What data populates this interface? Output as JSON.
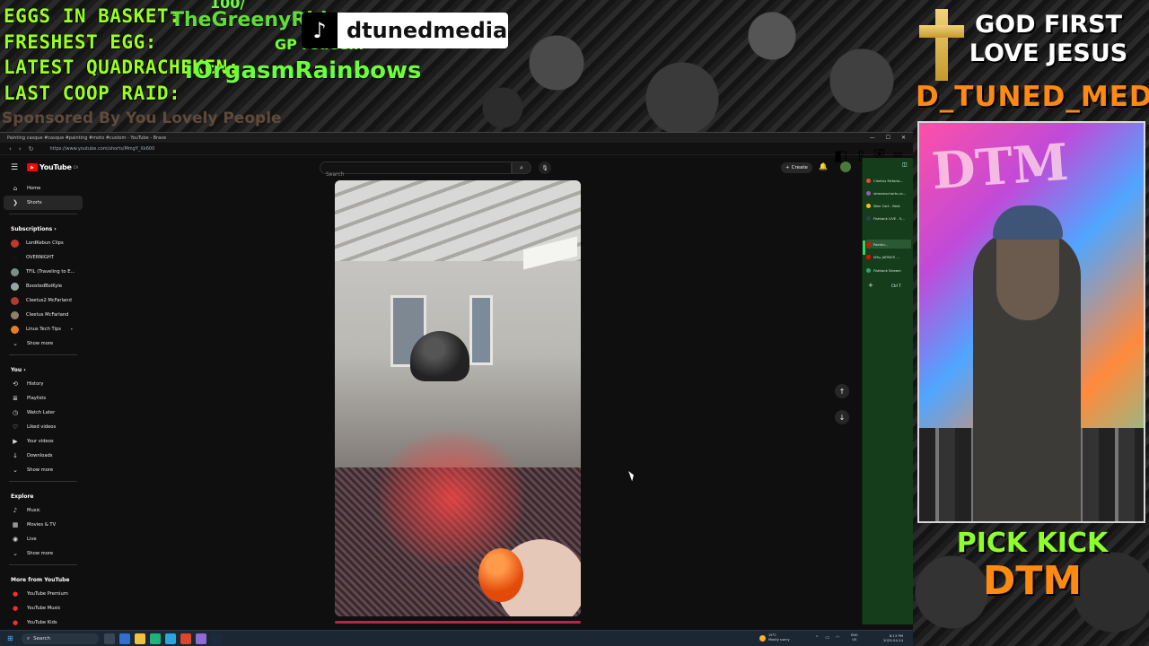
{
  "overlay": {
    "stats": [
      "EGGS IN BASKET:",
      "FRESHEST EGG:",
      "LATEST QUADRACHEKEN:",
      "LAST COOP RAID:"
    ],
    "sponsor": "Sponsored By You Lovely People",
    "alert_number": "100/",
    "alert_name": "TheGreenyRid",
    "alert_gp": "GP redeem",
    "alert_name2": "iOrgasmRainbows",
    "tiktok_handle": "dtunedmedia",
    "faith_text": "GOD FIRST LOVE JESUS",
    "channel_name": "D_TUNED_MEDIA",
    "pick_kick": "PICK KICK",
    "dtm": "DTM",
    "webcam_wall_text": "DTM"
  },
  "browser": {
    "window_title": "Painting casque #casque #painting #moto #custom - YouTube - Brave",
    "url": "https://www.youtube.com/shorts/MmgY_Xk600",
    "nav_back": "‹",
    "nav_fwd": "›",
    "reload": "↻"
  },
  "youtube": {
    "logo_text": "YouTube",
    "country": "CA",
    "search_placeholder": "Search",
    "create_label": "Create",
    "sidebar": {
      "main": [
        {
          "icon": "home-icon",
          "glyph": "⌂",
          "label": "Home",
          "active": false
        },
        {
          "icon": "shorts-icon",
          "glyph": "❯",
          "label": "Shorts",
          "active": true
        }
      ],
      "subscriptions_heading": "Subscriptions",
      "subscriptions": [
        {
          "label": "LordKebun Clips",
          "color": "#c0392b"
        },
        {
          "label": "OVERNIGHT",
          "color": "#111111"
        },
        {
          "label": "TFIL (Traveling to E...",
          "color": "#7f8c8d"
        },
        {
          "label": "BoostedBoiKyle",
          "color": "#95a5a6"
        },
        {
          "label": "Cleetus2 McFarland",
          "color": "#b03a2e"
        },
        {
          "label": "Cleetus McFarland",
          "color": "#8e7f6b"
        },
        {
          "label": "Linus Tech Tips",
          "color": "#e67e22"
        }
      ],
      "subs_show_more": "Show more",
      "you_heading": "You",
      "you_items": [
        {
          "icon": "history-icon",
          "glyph": "⟲",
          "label": "History"
        },
        {
          "icon": "playlists-icon",
          "glyph": "≣",
          "label": "Playlists"
        },
        {
          "icon": "watch-later-icon",
          "glyph": "◷",
          "label": "Watch Later"
        },
        {
          "icon": "liked-videos-icon",
          "glyph": "♡",
          "label": "Liked videos"
        },
        {
          "icon": "your-videos-icon",
          "glyph": "▶",
          "label": "Your videos"
        },
        {
          "icon": "downloads-icon",
          "glyph": "↓",
          "label": "Downloads"
        }
      ],
      "you_show_more": "Show more",
      "explore_heading": "Explore",
      "explore_items": [
        {
          "icon": "music-icon",
          "glyph": "♪",
          "label": "Music"
        },
        {
          "icon": "movies-icon",
          "glyph": "▦",
          "label": "Movies & TV"
        },
        {
          "icon": "live-icon",
          "glyph": "◉",
          "label": "Live"
        }
      ],
      "explore_show_more": "Show more",
      "more_heading": "More from YouTube",
      "more_items": [
        {
          "label": "YouTube Premium"
        },
        {
          "label": "YouTube Music"
        },
        {
          "label": "YouTube Kids"
        }
      ]
    },
    "short_nav": {
      "up": "↑",
      "down": "↓"
    }
  },
  "side_panel": {
    "tabs": [
      {
        "label": "Cleetus Mcfarla...",
        "color": "#e74c3c"
      },
      {
        "label": "streamscharts.co...",
        "color": "#9b59b6"
      },
      {
        "label": "Wan Cart - Best",
        "color": "#f1c40f"
      },
      {
        "label": "Fishtank LIVE - S...",
        "color": "#2c3e50"
      },
      {
        "label": "Paintin...",
        "color": "#ff0000"
      },
      {
        "label": "Why JAPAN'S ...",
        "color": "#ff0000"
      },
      {
        "label": "Fishtank Stream",
        "color": "#27ae60"
      }
    ],
    "ctrl_label": "Ctrl T"
  },
  "taskbar": {
    "search_label": "Search",
    "weather_temp": "19°C",
    "weather_desc": "Mostly sunny",
    "lang_top": "ENG",
    "lang_bottom": "US",
    "time": "8:13 PM",
    "date": "2025-04-14"
  },
  "colors": {
    "overlay_green": "#9bff1f",
    "overlay_orange": "#ff8a12",
    "yt_red": "#ff0000",
    "side_panel": "#153d1c"
  }
}
